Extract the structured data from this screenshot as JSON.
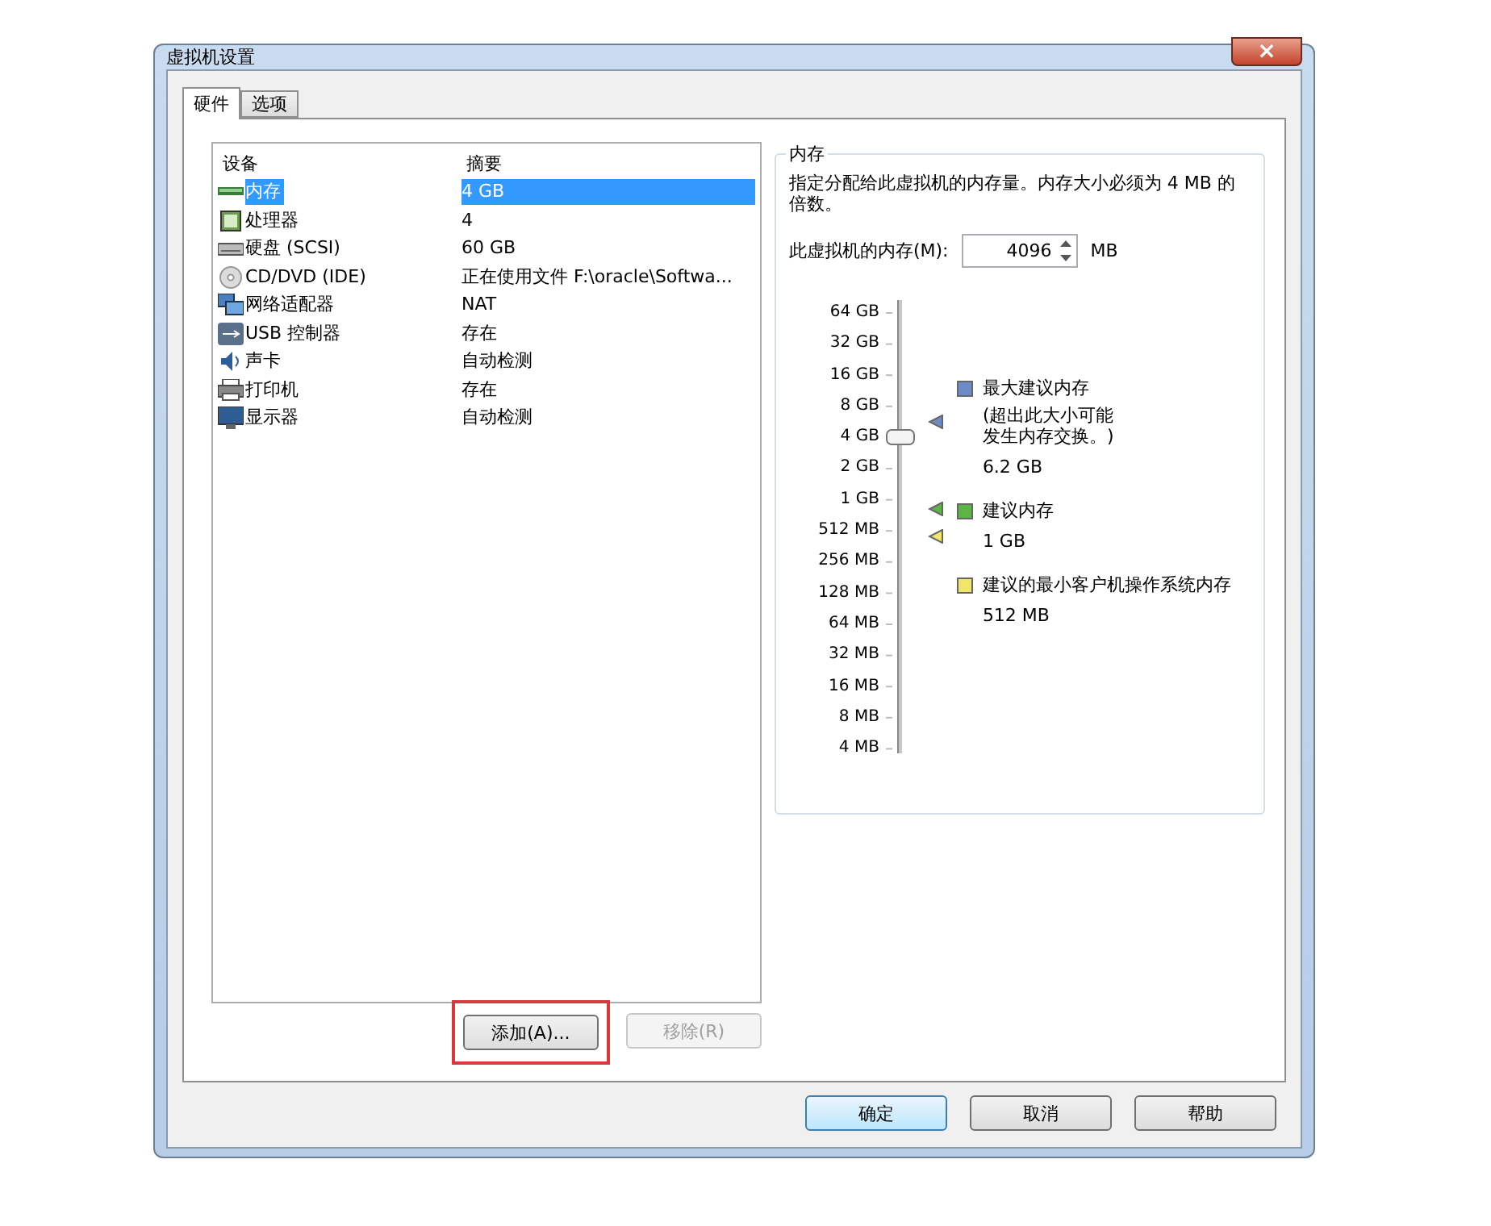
{
  "window": {
    "title": "虚拟机设置",
    "close": "×"
  },
  "tabs": [
    {
      "label": "硬件",
      "selected": true
    },
    {
      "label": "选项",
      "selected": false
    }
  ],
  "device_list": {
    "columns": [
      "设备",
      "摘要"
    ],
    "rows": [
      {
        "kind": "memory",
        "device": "内存",
        "summary": "4 GB",
        "selected": true
      },
      {
        "kind": "cpu",
        "device": "处理器",
        "summary": "4",
        "selected": false
      },
      {
        "kind": "disk",
        "device": "硬盘 (SCSI)",
        "summary": "60 GB",
        "selected": false
      },
      {
        "kind": "cd",
        "device": "CD/DVD (IDE)",
        "summary": "正在使用文件 F:\\oracle\\Softwa...",
        "selected": false
      },
      {
        "kind": "network",
        "device": "网络适配器",
        "summary": "NAT",
        "selected": false
      },
      {
        "kind": "usb",
        "device": "USB 控制器",
        "summary": "存在",
        "selected": false
      },
      {
        "kind": "sound",
        "device": "声卡",
        "summary": "自动检测",
        "selected": false
      },
      {
        "kind": "printer",
        "device": "打印机",
        "summary": "存在",
        "selected": false
      },
      {
        "kind": "display",
        "device": "显示器",
        "summary": "自动检测",
        "selected": false
      }
    ]
  },
  "list_buttons": [
    {
      "label": "添加(A)...",
      "disabled": false,
      "highlighted": true
    },
    {
      "label": "移除(R)",
      "disabled": true,
      "highlighted": false
    }
  ],
  "memory_panel": {
    "title": "内存",
    "description": "指定分配给此虚拟机的内存量。内存大小必须为 4 MB 的倍数。",
    "field_label": "此虚拟机的内存(M):",
    "value": "4096",
    "unit": "MB",
    "ticks": [
      "64 GB",
      "32 GB",
      "16 GB",
      "8 GB",
      "4 GB",
      "2 GB",
      "1 GB",
      "512 MB",
      "256 MB",
      "128 MB",
      "64 MB",
      "32 MB",
      "16 MB",
      "8 MB",
      "4 MB"
    ],
    "slider": {
      "level": 0.714
    },
    "legend": [
      {
        "title": "最大建议内存",
        "note": "(超出此大小可能发生内存交换。)",
        "value": "6.2 GB",
        "color": "#6b8cc7"
      },
      {
        "title": "建议内存",
        "value": "1 GB",
        "color": "#5cb545"
      },
      {
        "title": "建议的最小客户机操作系统内存",
        "value": "512 MB",
        "color": "#f2e66a"
      }
    ]
  },
  "dialog_buttons": [
    {
      "label": "确定",
      "default": true
    },
    {
      "label": "取消",
      "default": false
    },
    {
      "label": "帮助",
      "default": false
    }
  ]
}
